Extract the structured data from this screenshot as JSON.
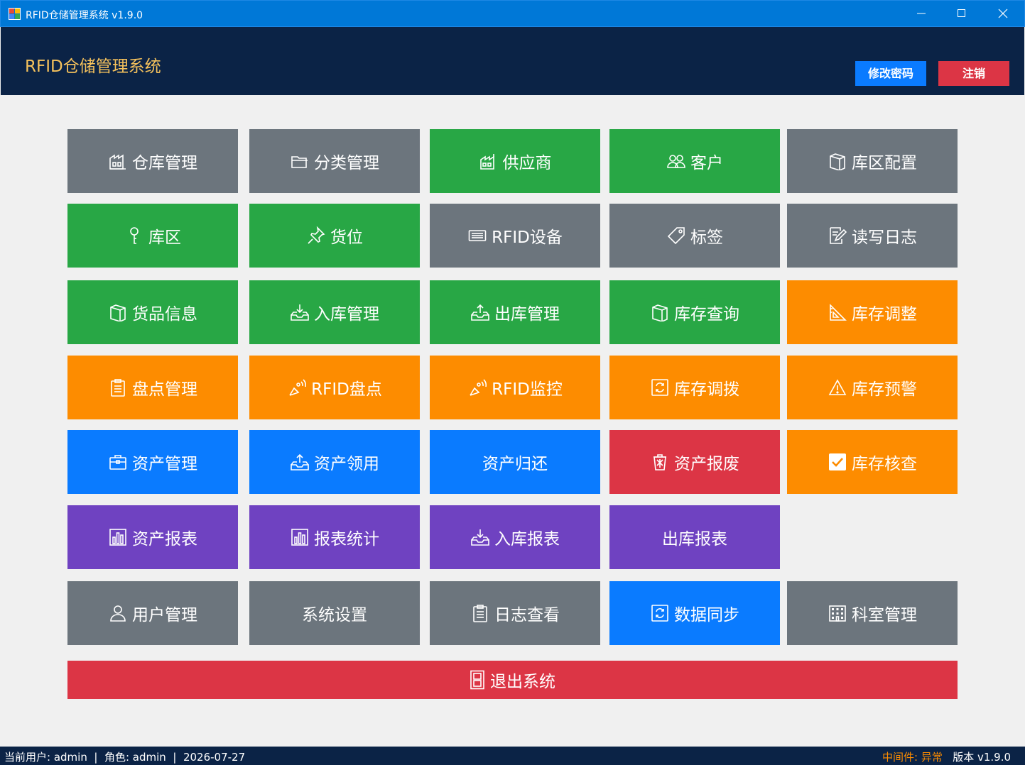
{
  "window": {
    "title": "RFID仓储管理系统 v1.9.0"
  },
  "header": {
    "brand": "RFID仓储管理系统",
    "change_password": "修改密码",
    "logout": "注销"
  },
  "colors": {
    "gray": "#6c757d",
    "green": "#28a745",
    "orange": "#fd8c00",
    "blue": "#0a7bff",
    "red": "#dc3545",
    "purple": "#6f42c1",
    "header_bg": "#0b2346",
    "brand_text": "#f6c25c"
  },
  "tiles": [
    {
      "label": "仓库管理",
      "icon": "warehouse-icon",
      "color": "gray"
    },
    {
      "label": "分类管理",
      "icon": "folder-icon",
      "color": "gray"
    },
    {
      "label": "供应商",
      "icon": "factory-icon",
      "color": "green"
    },
    {
      "label": "客户",
      "icon": "users-icon",
      "color": "green"
    },
    {
      "label": "库区配置",
      "icon": "box-icon",
      "color": "gray"
    },
    {
      "label": "库区",
      "icon": "key-icon",
      "color": "green"
    },
    {
      "label": "货位",
      "icon": "pin-icon",
      "color": "green"
    },
    {
      "label": "RFID设备",
      "icon": "device-icon",
      "color": "gray"
    },
    {
      "label": "标签",
      "icon": "tag-icon",
      "color": "gray"
    },
    {
      "label": "读写日志",
      "icon": "edit-doc-icon",
      "color": "gray"
    },
    {
      "label": "货品信息",
      "icon": "box-icon",
      "color": "green"
    },
    {
      "label": "入库管理",
      "icon": "inbox-in-icon",
      "color": "green"
    },
    {
      "label": "出库管理",
      "icon": "inbox-out-icon",
      "color": "green"
    },
    {
      "label": "库存查询",
      "icon": "box-icon",
      "color": "green"
    },
    {
      "label": "库存调整",
      "icon": "ruler-triangle-icon",
      "color": "orange"
    },
    {
      "label": "盘点管理",
      "icon": "clipboard-icon",
      "color": "orange"
    },
    {
      "label": "RFID盘点",
      "icon": "antenna-icon",
      "color": "orange"
    },
    {
      "label": "RFID监控",
      "icon": "antenna-icon",
      "color": "orange"
    },
    {
      "label": "库存调拨",
      "icon": "refresh-icon",
      "color": "orange"
    },
    {
      "label": "库存预警",
      "icon": "warning-icon",
      "color": "orange"
    },
    {
      "label": "资产管理",
      "icon": "briefcase-icon",
      "color": "blue"
    },
    {
      "label": "资产领用",
      "icon": "inbox-out-icon",
      "color": "blue"
    },
    {
      "label": "资产归还",
      "icon": "",
      "color": "blue"
    },
    {
      "label": "资产报废",
      "icon": "trash-icon",
      "color": "red"
    },
    {
      "label": "库存核查",
      "icon": "checkbox-icon",
      "color": "orange"
    },
    {
      "label": "资产报表",
      "icon": "bar-chart-icon",
      "color": "purple"
    },
    {
      "label": "报表统计",
      "icon": "bar-chart-icon",
      "color": "purple"
    },
    {
      "label": "入库报表",
      "icon": "inbox-in-icon",
      "color": "purple"
    },
    {
      "label": "出库报表",
      "icon": "",
      "color": "purple"
    },
    {
      "label": "用户管理",
      "icon": "user-icon",
      "color": "gray"
    },
    {
      "label": "系统设置",
      "icon": "",
      "color": "gray"
    },
    {
      "label": "日志查看",
      "icon": "clipboard-icon",
      "color": "gray"
    },
    {
      "label": "数据同步",
      "icon": "refresh-icon",
      "color": "blue"
    },
    {
      "label": "科室管理",
      "icon": "building-icon",
      "color": "gray"
    }
  ],
  "exit": {
    "label": "退出系统",
    "icon": "door-icon"
  },
  "status": {
    "user": "当前用户: admin",
    "role": "角色: admin",
    "date": "2026-07-27",
    "sep": "|",
    "middleware": "中间件: 异常",
    "version": "版本 v1.9.0"
  }
}
